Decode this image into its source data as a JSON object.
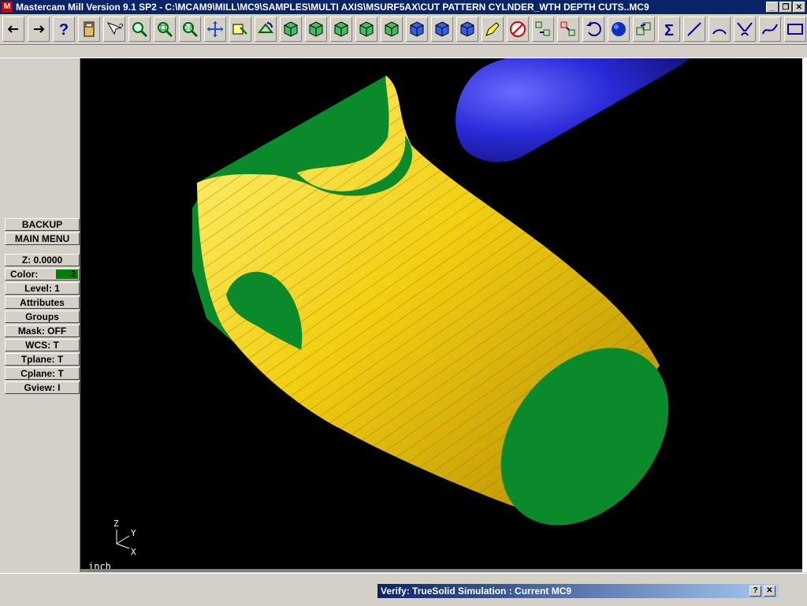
{
  "window": {
    "title": "Mastercam Mill Version 9.1 SP2 - C:\\MCAM9\\MILL\\MC9\\SAMPLES\\MULTI AXIS\\MSURF5AX\\CUT PATTERN CYLNDER_WTH DEPTH CUTS..MC9",
    "app_icon": "M",
    "controls": {
      "minimize": "_",
      "restore": "❐",
      "close": "✕"
    }
  },
  "toolbar": {
    "buttons": [
      {
        "name": "back-arrow-icon",
        "glyph": "←"
      },
      {
        "name": "forward-arrow-icon",
        "glyph": "→"
      },
      {
        "name": "help-icon",
        "glyph": "?"
      },
      {
        "name": "calculator-icon",
        "glyph": ""
      },
      {
        "name": "whats-this-icon",
        "glyph": ""
      },
      {
        "name": "zoom-window-icon",
        "glyph": ""
      },
      {
        "name": "zoom-fit-icon",
        "glyph": ""
      },
      {
        "name": "zoom-scale-icon",
        "glyph": ""
      },
      {
        "name": "pan-icon",
        "glyph": ""
      },
      {
        "name": "select-icon",
        "glyph": ""
      },
      {
        "name": "rotate-view-icon",
        "glyph": ""
      },
      {
        "name": "iso-view-icon",
        "glyph": ""
      },
      {
        "name": "top-view-icon",
        "glyph": ""
      },
      {
        "name": "front-view-icon",
        "glyph": ""
      },
      {
        "name": "side-view-icon",
        "glyph": ""
      },
      {
        "name": "shaded-cube-icon",
        "glyph": ""
      },
      {
        "name": "cube-blue-icon",
        "glyph": ""
      },
      {
        "name": "cube-blue-2-icon",
        "glyph": ""
      },
      {
        "name": "cube-blue-3-icon",
        "glyph": ""
      },
      {
        "name": "pencil-icon",
        "glyph": ""
      },
      {
        "name": "no-delete-icon",
        "glyph": ""
      },
      {
        "name": "translate-icon",
        "glyph": ""
      },
      {
        "name": "copy-icon",
        "glyph": ""
      },
      {
        "name": "undo-icon",
        "glyph": ""
      },
      {
        "name": "sphere-icon",
        "glyph": ""
      },
      {
        "name": "transform-icon",
        "glyph": ""
      },
      {
        "name": "sigma-icon",
        "glyph": "Σ"
      },
      {
        "name": "line-icon",
        "glyph": ""
      },
      {
        "name": "arc-icon",
        "glyph": ""
      },
      {
        "name": "fillet-icon",
        "glyph": ""
      },
      {
        "name": "spline-icon",
        "glyph": ""
      },
      {
        "name": "rectangle-icon",
        "glyph": ""
      }
    ]
  },
  "menu": {
    "backup": "BACKUP",
    "main_menu": "MAIN MENU",
    "z": "Z:  0.0000",
    "color_label": "Color:",
    "color_value": "2",
    "level": "Level:  1",
    "attributes": "Attributes",
    "groups": "Groups",
    "mask": "Mask:  OFF",
    "wcs": "WCS:   T",
    "tplane": "Tplane:  T",
    "cplane": "Cplane:  T",
    "gview": "Gview:   I"
  },
  "viewport": {
    "units": "inch",
    "axes": {
      "z": "Z",
      "y": "Y",
      "x": "X"
    },
    "colors": {
      "stock_green": "#0a8a2a",
      "cut_yellow": "#f0cc10",
      "tool_blue": "#2a2ad8",
      "background": "#000000"
    }
  },
  "verify": {
    "title": "Verify: TrueSolid Simulation : Current MC9",
    "help": "?",
    "close": "✕"
  }
}
